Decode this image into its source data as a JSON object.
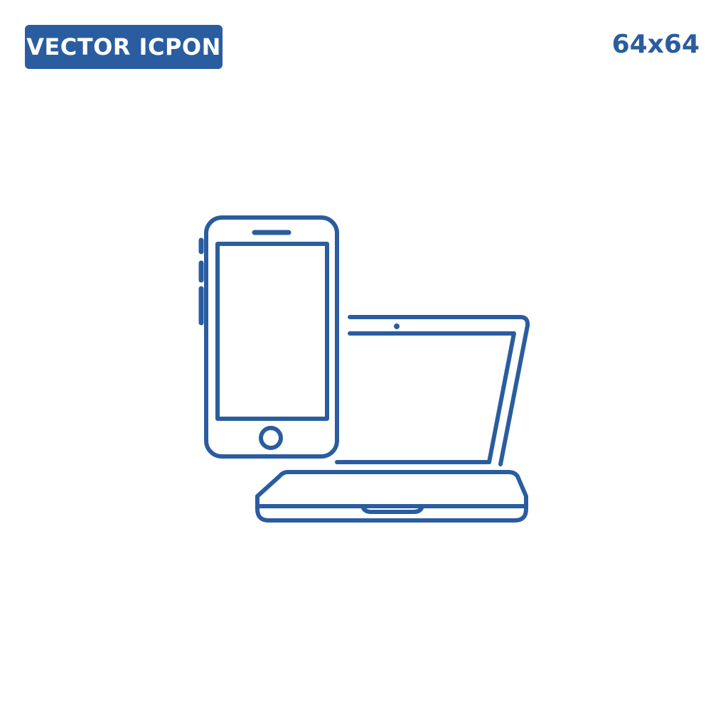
{
  "header": {
    "badge_label": "VECTOR ICPON",
    "size_label": "64x64"
  },
  "icon": {
    "name": "smartphone-laptop-icon",
    "stroke_color": "#2a5d9f"
  },
  "colors": {
    "accent": "#2a5d9f",
    "background": "#ffffff",
    "badge_text": "#ffffff"
  }
}
